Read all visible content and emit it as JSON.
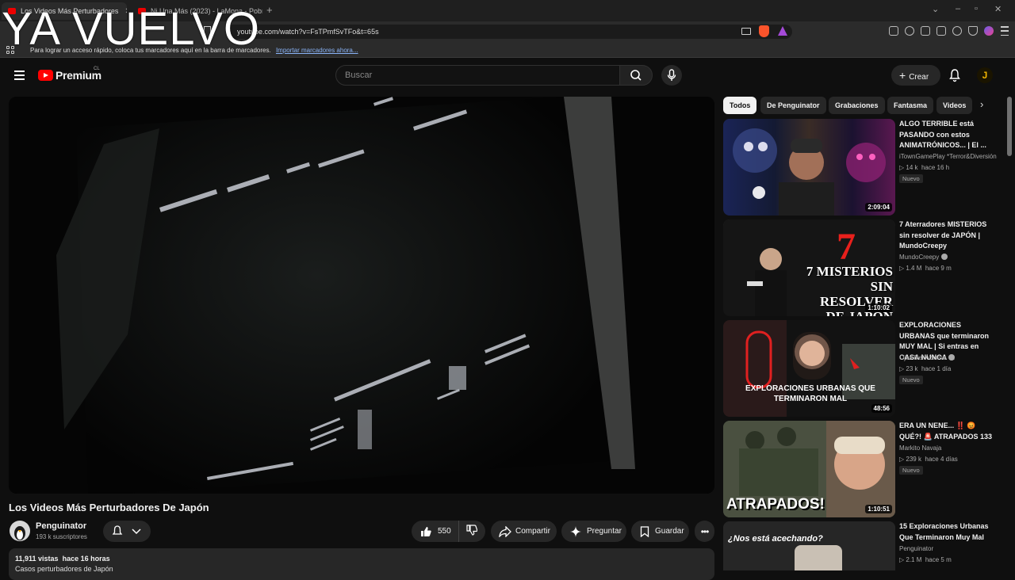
{
  "overlay_text": "YA VUELVO",
  "browser": {
    "tabs": [
      {
        "title": "Los Videos Más Perturbadores"
      },
      {
        "title": "Ni Una Más (2023) - LaMona - Pobre"
      }
    ],
    "url": "youtube.com/watch?v=FsTPmfSvTFo&t=65s",
    "bookmarks_prompt": "Para lograr un acceso rápido, coloca tus marcadores aquí en la barra de marcadores.",
    "bookmarks_import": "Importar marcadores ahora..."
  },
  "youtube": {
    "logo_text": "Premium",
    "logo_region": "CL",
    "search_placeholder": "Buscar",
    "create_label": "Crear",
    "avatar_letter": "J"
  },
  "video": {
    "title": "Los Videos Más Perturbadores De Japón",
    "channel": "Penguinator",
    "subscribers": "193 k suscriptores",
    "likes": "550",
    "share_label": "Compartir",
    "ask_label": "Preguntar",
    "save_label": "Guardar",
    "views": "11,911 vistas",
    "published": "hace 16 horas",
    "description_start": "Casos perturbadores de Japón"
  },
  "chips": [
    "Todos",
    "De Penguinator",
    "Grabaciones",
    "Fantasma",
    "Videos"
  ],
  "recommendations": [
    {
      "title": "ALGO TERRIBLE está PASANDO con estos ANIMATRÓNICOS... | El ...",
      "channel": "iTownGamePlay *Terror&Diversión",
      "views": "14 k",
      "age": "hace 16 h",
      "badge": "Nuevo",
      "duration": "2:09:04"
    },
    {
      "title": "7 Aterradores MISTERIOS sin resolver de JAPÓN | MundoCreepy",
      "channel": "MundoCreepy",
      "views": "1.4 M",
      "age": "hace 9 m",
      "badge": "",
      "duration": "1:10:02",
      "thumb_text": "7 MISTERIOS SIN RESOLVER DE JAPON"
    },
    {
      "title": "EXPLORACIONES URBANAS que terminaron MUY MAL | Si entras en CASA NUNCA ...",
      "channel": "Ojos Del Abismo",
      "views": "23 k",
      "age": "hace 1 día",
      "badge": "Nuevo",
      "duration": "48:56",
      "thumb_text": "EXPLORACIONES URBANAS QUE TERMINARON MAL"
    },
    {
      "title": "ERA UN NENE... ‼️ 😡 QUÉ?! 🚨 ATRAPADOS 133",
      "channel": "Markito Navaja",
      "views": "239 k",
      "age": "hace 4 días",
      "badge": "Nuevo",
      "duration": "1:10:51",
      "thumb_text": "ATRAPADOS!"
    },
    {
      "title": "15 Exploraciones Urbanas Que Terminaron Muy Mal",
      "channel": "Penguinator",
      "views": "2.1 M",
      "age": "hace 5 m",
      "badge": "",
      "duration": "",
      "thumb_text": "¿Nos está acechando?"
    }
  ]
}
